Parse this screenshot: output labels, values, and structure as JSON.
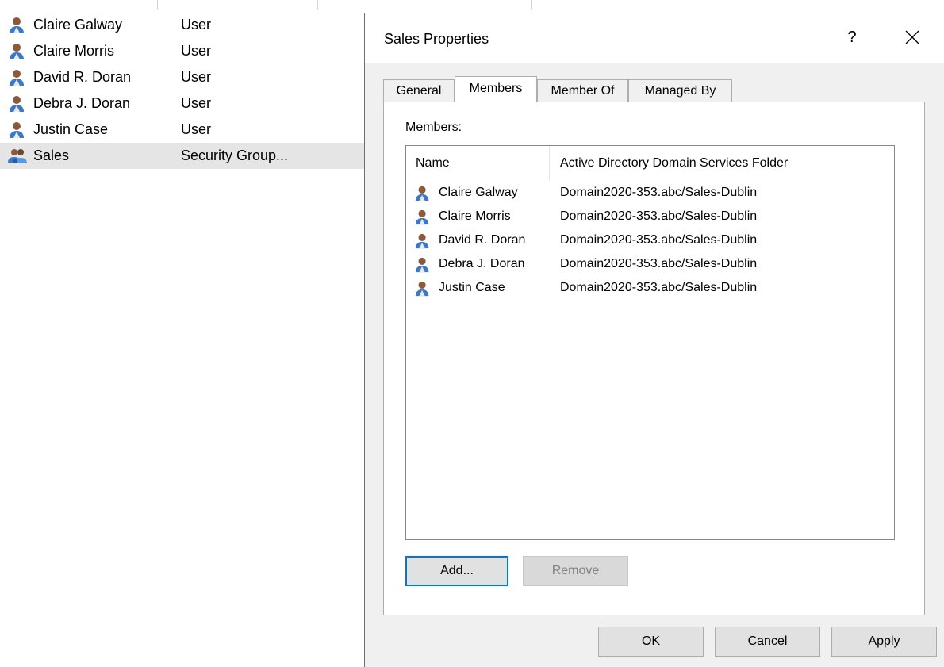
{
  "background": {
    "rows": [
      {
        "name": "Claire Galway",
        "type": "User",
        "icon": "user-icon"
      },
      {
        "name": "Claire Morris",
        "type": "User",
        "icon": "user-icon"
      },
      {
        "name": "David R. Doran",
        "type": "User",
        "icon": "user-icon"
      },
      {
        "name": "Debra J. Doran",
        "type": "User",
        "icon": "user-icon"
      },
      {
        "name": "Justin Case",
        "type": "User",
        "icon": "user-icon"
      },
      {
        "name": "Sales",
        "type": "Security Group...",
        "icon": "group-icon",
        "selected": true
      }
    ]
  },
  "dialog": {
    "title": "Sales Properties",
    "help_label": "?",
    "close_icon": "close-icon",
    "tabs": [
      {
        "label": "General"
      },
      {
        "label": "Members",
        "active": true
      },
      {
        "label": "Member Of"
      },
      {
        "label": "Managed By"
      }
    ],
    "members_label": "Members:",
    "columns": {
      "name": "Name",
      "folder": "Active Directory Domain Services Folder"
    },
    "members": [
      {
        "name": "Claire Galway",
        "folder": "Domain2020-353.abc/Sales-Dublin"
      },
      {
        "name": "Claire Morris",
        "folder": "Domain2020-353.abc/Sales-Dublin"
      },
      {
        "name": "David R. Doran",
        "folder": "Domain2020-353.abc/Sales-Dublin"
      },
      {
        "name": "Debra J. Doran",
        "folder": "Domain2020-353.abc/Sales-Dublin"
      },
      {
        "name": "Justin Case",
        "folder": "Domain2020-353.abc/Sales-Dublin"
      }
    ],
    "buttons": {
      "add": "Add...",
      "remove": "Remove",
      "ok": "OK",
      "cancel": "Cancel",
      "apply": "Apply"
    }
  },
  "colors": {
    "focus_border": "#0078d7",
    "selected_row": "#e5e5e5",
    "dialog_bg": "#f0f0f0"
  }
}
